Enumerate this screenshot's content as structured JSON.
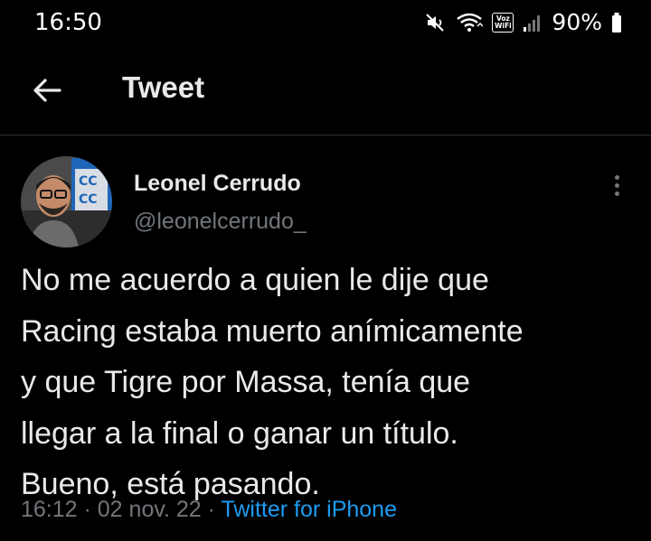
{
  "status_bar": {
    "time": "16:50",
    "voz_top": "Voz",
    "voz_bottom": "WiFi",
    "wifi_sub": "1",
    "battery": "90%",
    "icons": [
      "mute-icon",
      "wifi-icon",
      "voz-wifi-icon",
      "signal-icon",
      "battery-icon"
    ]
  },
  "header": {
    "title": "Tweet",
    "back_icon": "arrow-left-icon"
  },
  "tweet": {
    "author_name": "Leonel Cerrudo",
    "author_handle": "@leonelcerrudo_",
    "lines": [
      "No me acuerdo a quien le dije que",
      "Racing estaba muerto anímicamente",
      "y que Tigre por Massa, tenía que",
      "llegar a la final o ganar un título.",
      "Bueno, está pasando."
    ],
    "time": "16:12",
    "sep1": " · ",
    "date": "02 nov. 22",
    "sep2": " · ",
    "source": "Twitter for iPhone"
  },
  "colors": {
    "background": "#000000",
    "text": "#e7e9ea",
    "muted": "#71767b",
    "link": "#1d9bf0",
    "divider": "#2f3336"
  }
}
